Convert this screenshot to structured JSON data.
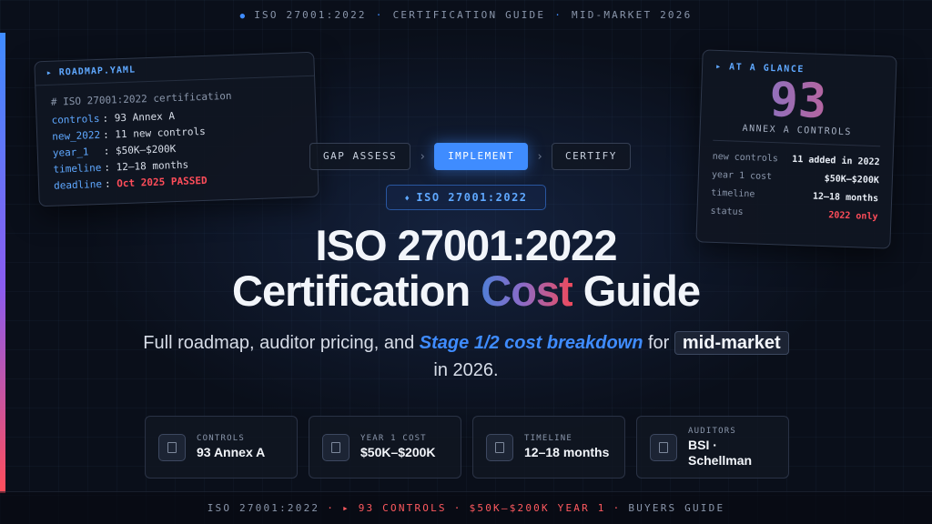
{
  "top_strip": {
    "items": [
      "ISO 27001:2022",
      "CERTIFICATION GUIDE",
      "MID-MARKET 2026"
    ]
  },
  "yaml_card": {
    "title": "▸ ROADMAP.YAML",
    "comment": "# ISO 27001:2022 certification",
    "rows": [
      {
        "key": "controls",
        "value": "93 Annex A"
      },
      {
        "key": "new_2022",
        "value": "11 new controls"
      },
      {
        "key": "year_1",
        "value": "$50K–$200K"
      },
      {
        "key": "timeline",
        "value": "12–18 months"
      },
      {
        "key": "deadline",
        "value": "Oct 2025 PASSED"
      }
    ]
  },
  "glance_card": {
    "title": "▸ AT A GLANCE",
    "big_number": "93",
    "big_label": "ANNEX A CONTROLS",
    "rows": [
      {
        "key": "new controls",
        "value": "11 added in 2022"
      },
      {
        "key": "year 1 cost",
        "value": "$50K–$200K"
      },
      {
        "key": "timeline",
        "value": "12–18 months"
      },
      {
        "key": "status",
        "value": "2022 only"
      }
    ]
  },
  "steps": [
    "GAP ASSESS",
    "IMPLEMENT",
    "CERTIFY"
  ],
  "active_step": "IMPLEMENT",
  "tag": "ISO 27001:2022",
  "title": {
    "line1": "ISO 27001:2022",
    "line2_pre": "Certification ",
    "line2_accent": "Cost",
    "line2_post": " Guide"
  },
  "subtitle": {
    "pre": "Full roadmap, auditor pricing, and ",
    "accent": "Stage 1/2 cost breakdown",
    "mid": " for ",
    "chip": "mid-market",
    "post": "in 2026."
  },
  "stats": [
    {
      "label": "CONTROLS",
      "value": "93 Annex A"
    },
    {
      "label": "YEAR 1 COST",
      "value": "$50K–$200K"
    },
    {
      "label": "TIMELINE",
      "value": "12–18 months"
    },
    {
      "label": "AUDITORS",
      "value": "BSI · Schellman"
    }
  ],
  "bottom_strip": {
    "item1": "ISO 27001:2022",
    "item2": "▸ 93 CONTROLS",
    "item3": "$50K–$200K YEAR 1",
    "item4": "BUYERS GUIDE"
  },
  "colors": {
    "accent_blue": "#3f8cff",
    "accent_red": "#ff4d5a",
    "background": "#0a0f1a"
  }
}
